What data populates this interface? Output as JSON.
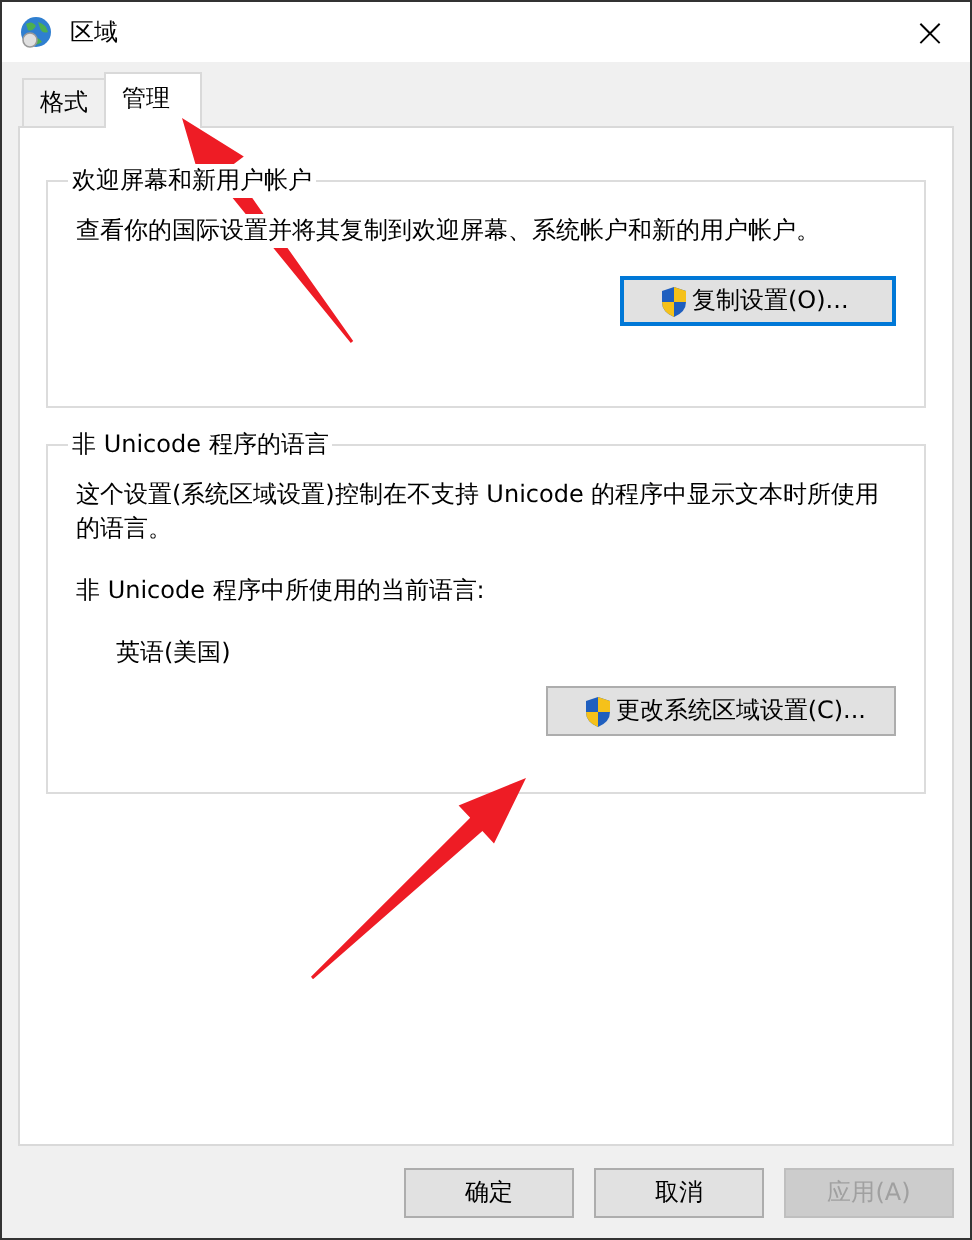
{
  "window": {
    "title": "区域",
    "close": "×"
  },
  "tabs": [
    {
      "label": "格式",
      "selected": false
    },
    {
      "label": "管理",
      "selected": true
    }
  ],
  "groups": [
    {
      "title": "欢迎屏幕和新用户帐户",
      "lines": [
        {
          "kind": "text",
          "text": "查看你的国际设置并将其复制到欢迎屏幕、系统帐户和新的用户帐户。"
        }
      ],
      "button": {
        "label": "复制设置(O)...",
        "focused": true
      }
    },
    {
      "title": "非 Unicode 程序的语言",
      "lines": [
        {
          "kind": "text",
          "text": "这个设置(系统区域设置)控制在不支持 Unicode 的程序中显示文本时所使用的语言。"
        },
        {
          "kind": "text",
          "text": "非 Unicode 程序中所使用的当前语言:"
        },
        {
          "kind": "value",
          "text": "英语(美国)"
        }
      ],
      "button": {
        "label": "更改系统区域设置(C)...",
        "focused": false
      }
    }
  ],
  "buttons": [
    {
      "label": "确定",
      "disabled": false
    },
    {
      "label": "取消",
      "disabled": false
    },
    {
      "label": "应用(A)",
      "disabled": true
    }
  ],
  "annotations": [
    {
      "kind": "arrow"
    },
    {
      "kind": "arrow"
    }
  ]
}
